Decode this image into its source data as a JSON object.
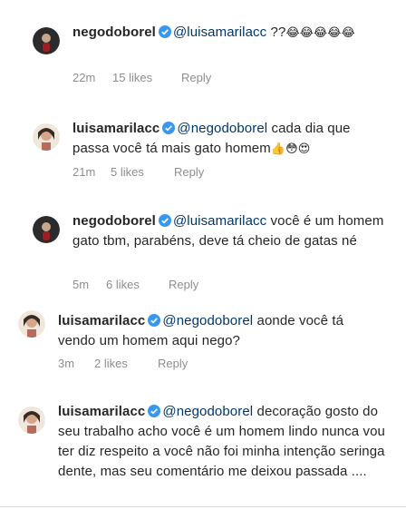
{
  "comments": [
    {
      "username": "negodoborel",
      "mention": "@luisamarilacc",
      "text": "??",
      "emoji": "😂😂😂😂😂",
      "time": "22m",
      "likes": "15 likes",
      "reply": "Reply"
    },
    {
      "username": "luisamarilacc",
      "mention": "@negodoborel",
      "text": "cada dia que passa você tá mais gato homem",
      "emoji": "👍😳😍",
      "time": "21m",
      "likes": "5 likes",
      "reply": "Reply"
    },
    {
      "username": "negodoborel",
      "mention": "@luisamarilacc",
      "text": "você é um homem gato tbm, parabéns, deve tá cheio de gatas né",
      "emoji": "",
      "time": "5m",
      "likes": "6 likes",
      "reply": "Reply"
    },
    {
      "username": "luisamarilacc",
      "mention": "@negodoborel",
      "text": "aonde você tá vendo um homem aqui nego?",
      "emoji": "",
      "time": "3m",
      "likes": "2 likes",
      "reply": "Reply"
    },
    {
      "username": "luisamarilacc",
      "mention": "@negodoborel",
      "text": "decoração gosto do seu trabalho acho você é um homem lindo nunca vou ter diz respeito a você não foi minha intenção seringa dente, mas seu comentário me deixou passada ....",
      "emoji": "",
      "time": "",
      "likes": "",
      "reply": ""
    }
  ],
  "colors": {
    "verified": "#3897f0",
    "mention": "#00376b",
    "meta": "#8e8e8e",
    "text": "#262626"
  }
}
